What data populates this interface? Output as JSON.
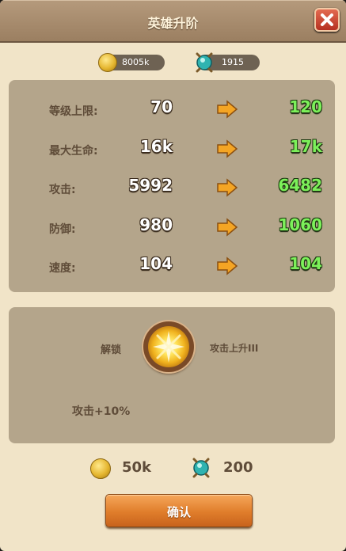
{
  "header": {
    "title": "英雄升阶"
  },
  "currency": {
    "gold": "8005k",
    "gems": "1915"
  },
  "stats": [
    {
      "label": "等级上限:",
      "current": "70",
      "next": "120"
    },
    {
      "label": "最大生命:",
      "current": "16k",
      "next": "17k"
    },
    {
      "label": "攻击:",
      "current": "5992",
      "next": "6482"
    },
    {
      "label": "防御:",
      "current": "980",
      "next": "1060"
    },
    {
      "label": "速度:",
      "current": "104",
      "next": "104"
    }
  ],
  "skill": {
    "unlock_label": "解锁",
    "name": "攻击上升III",
    "description": "攻击+10%"
  },
  "cost": {
    "gold": "50k",
    "gems": "200"
  },
  "confirm_label": "确认",
  "colors": {
    "accent": "#e07d2b",
    "new_value": "#7cf05a",
    "panel": "#f1e4c8"
  }
}
